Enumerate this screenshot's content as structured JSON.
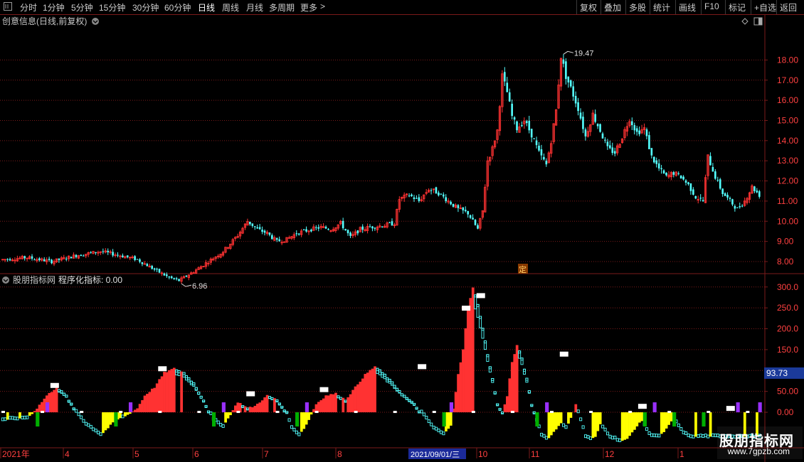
{
  "toolbar": {
    "left_tabs": [
      "分时",
      "1分钟",
      "5分钟",
      "15分钟",
      "30分钟",
      "60分钟",
      "日线",
      "周线",
      "月线",
      "多周期",
      "更多"
    ],
    "active_tab": "日线",
    "more_arrow": ">",
    "right_buttons": [
      "复权",
      "叠加",
      "多股",
      "统计",
      "画线",
      "F10",
      "标记",
      "+自选",
      "返回"
    ]
  },
  "main_panel": {
    "title": "创意信息(日线,前复权)",
    "max_label": "19.47",
    "min_label": "6.96",
    "marker": "定",
    "y_ticks": [
      "18.00",
      "17.00",
      "16.00",
      "15.00",
      "14.00",
      "13.00",
      "12.00",
      "11.00",
      "10.00",
      "9.00",
      "8.00"
    ],
    "y_range": [
      7.4,
      20.2
    ]
  },
  "indicator_panel": {
    "title": "股朋指标网",
    "subtitle": "程序化指标: 0.00",
    "current_value": "93.73",
    "y_ticks": [
      "300.0",
      "250.0",
      "200.0",
      "150.0",
      "100.0",
      "50.00",
      "0.00"
    ],
    "y_range": [
      -85,
      320
    ]
  },
  "x_axis": {
    "labels": [
      "2021年",
      "4",
      "5",
      "6",
      "7",
      "8",
      "10",
      "11",
      "12",
      "1"
    ],
    "highlight_date": "2021/09/01/三"
  },
  "watermark": {
    "title": "股朋指标网",
    "url": "www.7gpzb.com"
  },
  "colors": {
    "up": "#ff3232",
    "down": "#54ffff",
    "grid": "#7a1a1a",
    "axis_text": "#ff4040",
    "yellow": "#ffff00",
    "green": "#00b000",
    "purple": "#9a30ff",
    "white": "#ffffff",
    "value_box": "#1b3a9a"
  },
  "chart_data": {
    "type": "candlestick",
    "price_anchors": [
      [
        0,
        8.1
      ],
      [
        10,
        8.2
      ],
      [
        20,
        8.0
      ],
      [
        30,
        8.3
      ],
      [
        40,
        8.5
      ],
      [
        48,
        8.3
      ],
      [
        55,
        8.1
      ],
      [
        62,
        7.6
      ],
      [
        68,
        7.2
      ],
      [
        72,
        7.05
      ],
      [
        78,
        7.5
      ],
      [
        84,
        8.0
      ],
      [
        90,
        8.5
      ],
      [
        96,
        9.3
      ],
      [
        100,
        10.0
      ],
      [
        104,
        9.6
      ],
      [
        108,
        9.4
      ],
      [
        112,
        9.0
      ],
      [
        116,
        9.1
      ],
      [
        120,
        9.4
      ],
      [
        126,
        9.6
      ],
      [
        130,
        9.7
      ],
      [
        134,
        9.6
      ],
      [
        138,
        9.9
      ],
      [
        142,
        9.2
      ],
      [
        146,
        9.6
      ],
      [
        150,
        9.7
      ],
      [
        156,
        9.8
      ],
      [
        160,
        9.9
      ],
      [
        162,
        11.1
      ],
      [
        166,
        11.3
      ],
      [
        170,
        11.0
      ],
      [
        174,
        11.6
      ],
      [
        178,
        11.4
      ],
      [
        182,
        11.0
      ],
      [
        186,
        10.6
      ],
      [
        190,
        10.4
      ],
      [
        194,
        9.6
      ],
      [
        196,
        10.5
      ],
      [
        198,
        13.0
      ],
      [
        200,
        13.6
      ],
      [
        202,
        14.5
      ],
      [
        204,
        17.2
      ],
      [
        206,
        16.4
      ],
      [
        208,
        15.2
      ],
      [
        210,
        14.6
      ],
      [
        213,
        15.0
      ],
      [
        216,
        14.3
      ],
      [
        219,
        13.4
      ],
      [
        222,
        12.8
      ],
      [
        224,
        14.0
      ],
      [
        226,
        15.5
      ],
      [
        228,
        18.2
      ],
      [
        230,
        17.2
      ],
      [
        232,
        16.6
      ],
      [
        235,
        15.6
      ],
      [
        238,
        14.2
      ],
      [
        241,
        15.3
      ],
      [
        244,
        14.5
      ],
      [
        247,
        13.6
      ],
      [
        250,
        13.4
      ],
      [
        253,
        14.2
      ],
      [
        256,
        15.1
      ],
      [
        259,
        14.4
      ],
      [
        262,
        14.6
      ],
      [
        265,
        13.2
      ],
      [
        268,
        12.6
      ],
      [
        271,
        12.2
      ],
      [
        274,
        12.4
      ],
      [
        277,
        12.2
      ],
      [
        280,
        11.8
      ],
      [
        283,
        11.2
      ],
      [
        286,
        11.0
      ],
      [
        288,
        13.2
      ],
      [
        291,
        12.2
      ],
      [
        294,
        11.4
      ],
      [
        297,
        11.0
      ],
      [
        300,
        10.6
      ],
      [
        303,
        11.0
      ],
      [
        306,
        11.7
      ],
      [
        309,
        11.3
      ]
    ],
    "indicator_anchors": [
      [
        0,
        -20
      ],
      [
        10,
        -15
      ],
      [
        14,
        10
      ],
      [
        18,
        40
      ],
      [
        22,
        60
      ],
      [
        26,
        40
      ],
      [
        30,
        0
      ],
      [
        34,
        -30
      ],
      [
        40,
        -55
      ],
      [
        46,
        -20
      ],
      [
        50,
        -10
      ],
      [
        55,
        10
      ],
      [
        58,
        40
      ],
      [
        62,
        60
      ],
      [
        66,
        95
      ],
      [
        70,
        105
      ],
      [
        74,
        95
      ],
      [
        78,
        70
      ],
      [
        82,
        30
      ],
      [
        86,
        -20
      ],
      [
        90,
        -35
      ],
      [
        93,
        -5
      ],
      [
        96,
        25
      ],
      [
        100,
        10
      ],
      [
        103,
        15
      ],
      [
        108,
        40
      ],
      [
        112,
        30
      ],
      [
        116,
        0
      ],
      [
        118,
        -40
      ],
      [
        121,
        -55
      ],
      [
        124,
        -30
      ],
      [
        128,
        20
      ],
      [
        132,
        40
      ],
      [
        136,
        45
      ],
      [
        140,
        30
      ],
      [
        144,
        60
      ],
      [
        148,
        90
      ],
      [
        152,
        110
      ],
      [
        156,
        90
      ],
      [
        160,
        65
      ],
      [
        164,
        40
      ],
      [
        168,
        20
      ],
      [
        172,
        -10
      ],
      [
        176,
        -40
      ],
      [
        180,
        -55
      ],
      [
        183,
        -30
      ],
      [
        186,
        90
      ],
      [
        188,
        150
      ],
      [
        190,
        250
      ],
      [
        192,
        300
      ],
      [
        194,
        260
      ],
      [
        196,
        200
      ],
      [
        198,
        140
      ],
      [
        200,
        80
      ],
      [
        202,
        20
      ],
      [
        204,
        0
      ],
      [
        206,
        40
      ],
      [
        208,
        120
      ],
      [
        210,
        160
      ],
      [
        212,
        130
      ],
      [
        214,
        80
      ],
      [
        216,
        20
      ],
      [
        218,
        -20
      ],
      [
        220,
        -55
      ],
      [
        222,
        -65
      ],
      [
        224,
        -55
      ],
      [
        226,
        -40
      ],
      [
        228,
        -25
      ],
      [
        230,
        -40
      ],
      [
        232,
        -15
      ],
      [
        234,
        20
      ],
      [
        236,
        -20
      ],
      [
        238,
        -60
      ],
      [
        240,
        -65
      ],
      [
        242,
        -60
      ],
      [
        244,
        -30
      ],
      [
        248,
        -60
      ],
      [
        252,
        -70
      ],
      [
        255,
        -65
      ],
      [
        258,
        -40
      ],
      [
        261,
        -20
      ],
      [
        264,
        -55
      ],
      [
        268,
        -60
      ],
      [
        271,
        -40
      ],
      [
        274,
        -15
      ],
      [
        277,
        -45
      ],
      [
        280,
        -60
      ]
    ]
  }
}
